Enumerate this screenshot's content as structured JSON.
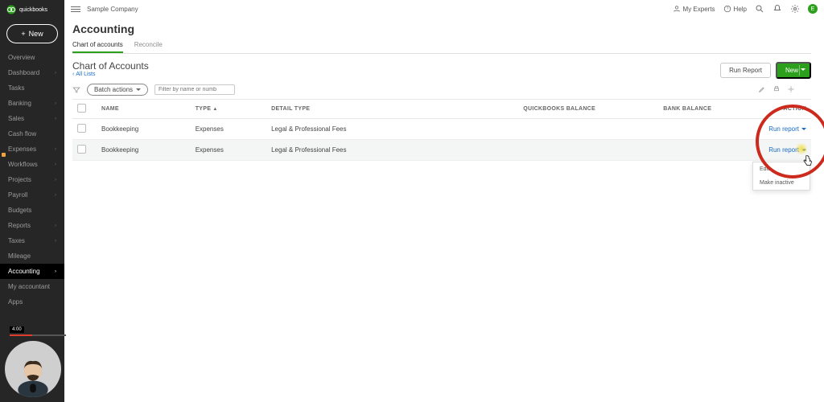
{
  "top": {
    "company": "Sample Company",
    "experts": "My Experts",
    "help": "Help",
    "user_letter": "E"
  },
  "brand": "quickbooks",
  "new_btn": "New",
  "nav_items": [
    {
      "label": "Overview"
    },
    {
      "label": "Dashboard",
      "caret": true
    },
    {
      "label": "Tasks"
    },
    {
      "label": "Banking",
      "caret": true
    },
    {
      "label": "Sales",
      "caret": true
    },
    {
      "label": "Cash flow"
    },
    {
      "label": "Expenses",
      "caret": true
    },
    {
      "label": "Workflows",
      "caret": true
    },
    {
      "label": "Projects",
      "caret": true
    },
    {
      "label": "Payroll",
      "caret": true
    },
    {
      "label": "Budgets"
    },
    {
      "label": "Reports",
      "caret": true
    },
    {
      "label": "Taxes",
      "caret": true
    },
    {
      "label": "Mileage"
    },
    {
      "label": "Accounting",
      "caret": true,
      "active": true
    },
    {
      "label": "My accountant"
    },
    {
      "label": "Apps"
    }
  ],
  "video_timestamp": "4:00",
  "page_title": "Accounting",
  "tabs": [
    {
      "label": "Chart of accounts",
      "active": true
    },
    {
      "label": "Reconcile"
    }
  ],
  "sub_title": "Chart of Accounts",
  "back_link": "All Lists",
  "buttons": {
    "run_report": "Run Report",
    "new": "New"
  },
  "toolbar": {
    "batch": "Batch actions",
    "search_placeholder": "Filter by name or numb"
  },
  "cols": {
    "name": "NAME",
    "type": "TYPE",
    "detail": "DETAIL TYPE",
    "qb": "QUICKBOOKS BALANCE",
    "bank": "BANK BALANCE",
    "action": "ACTION"
  },
  "rows": [
    {
      "name": "Bookkeeping",
      "type": "Expenses",
      "detail": "Legal & Professional Fees",
      "action": "Run report"
    },
    {
      "name": "Bookkeeping",
      "type": "Expenses",
      "detail": "Legal & Professional Fees",
      "action": "Run report",
      "selected": true
    }
  ],
  "menu": {
    "edit": "Edit",
    "make_inactive": "Make inactive"
  }
}
